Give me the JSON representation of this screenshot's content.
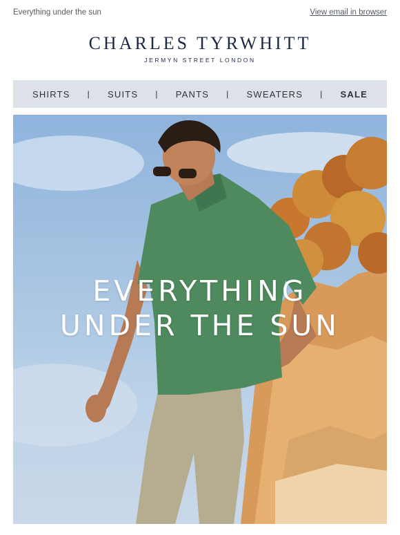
{
  "preheader": {
    "text": "Everything under the sun",
    "view_in_browser": "View email in browser"
  },
  "brand": {
    "name": "CHARLES TYRWHITT",
    "tagline": "JERMYN STREET LONDON"
  },
  "nav": {
    "items": [
      "SHIRTS",
      "SUITS",
      "PANTS",
      "SWEATERS",
      "SALE"
    ],
    "separator": "|"
  },
  "hero": {
    "line1": "EVERYTHING",
    "line2": "UNDER THE SUN",
    "image": "man-in-green-polo-by-sunlit-cliff"
  },
  "colors": {
    "brand_navy": "#1d2845",
    "nav_bg": "#dde1e8",
    "polo_green": "#4e8a5e"
  }
}
